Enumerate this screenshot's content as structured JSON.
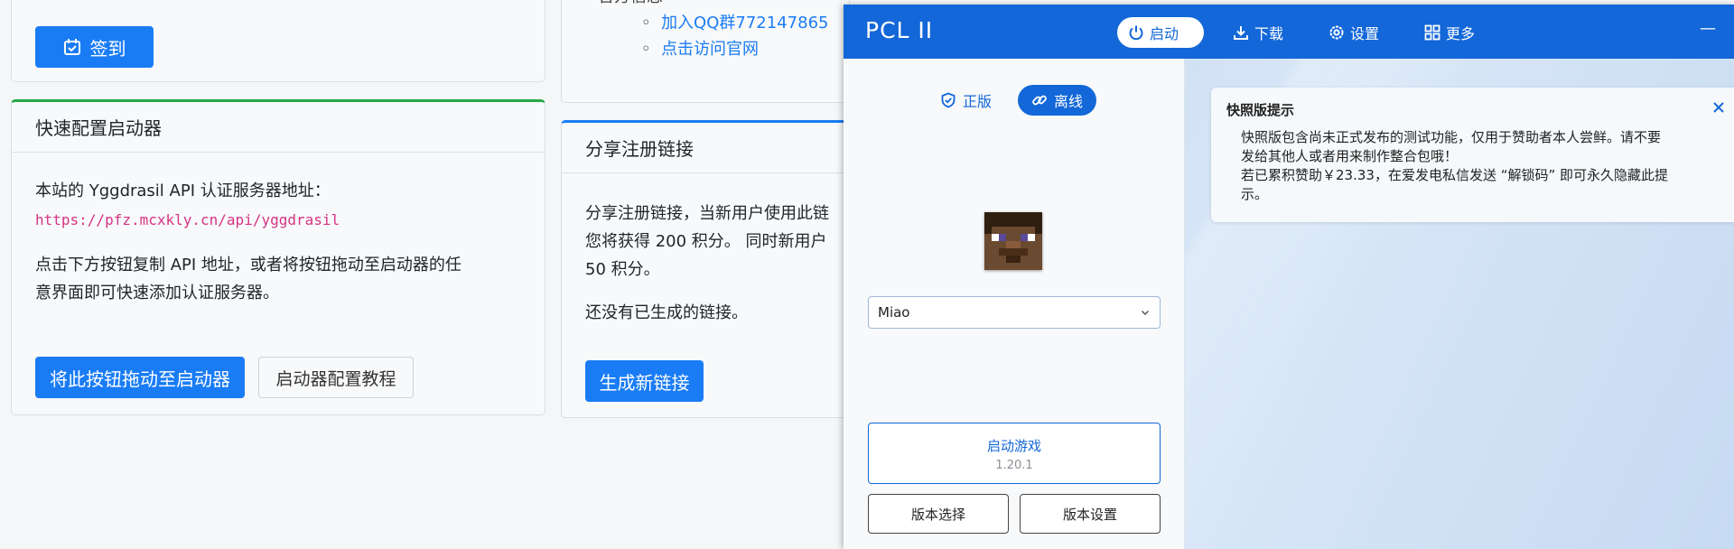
{
  "web": {
    "checkin_label": "签到",
    "quick_config": {
      "title": "快速配置启动器",
      "line1": "本站的 Yggdrasil API 认证服务器地址：",
      "api_url": "https://pfz.mcxkly.cn/api/yggdrasil",
      "line2a": "点击下方按钮复制 API 地址，或者将按钮拖动至启动器的任",
      "line2b": "意界面即可快速添加认证服务器。",
      "drag_button": "将此按钮拖动至启动器",
      "tutorial_button": "启动器配置教程"
    },
    "official": {
      "partial_heading": "官方信息",
      "link_qq": "加入QQ群772147865",
      "link_site": "点击访问官网"
    },
    "share": {
      "title": "分享注册链接",
      "line1": "分享注册链接，当新用户使用此链",
      "line2": "您将获得 200 积分。 同时新用户",
      "line3": "50 积分。",
      "none_text": "还没有已生成的链接。",
      "generate_button": "生成新链接"
    }
  },
  "pcl": {
    "title": "PCL II",
    "nav": [
      {
        "label": "启动",
        "icon": "power-icon",
        "active": true
      },
      {
        "label": "下载",
        "icon": "download-icon",
        "active": false
      },
      {
        "label": "设置",
        "icon": "gear-icon",
        "active": false
      },
      {
        "label": "更多",
        "icon": "grid-icon",
        "active": false
      }
    ],
    "minimize_symbol": "—",
    "login_modes": {
      "genuine": "正版",
      "offline": "离线"
    },
    "username": "Miao",
    "launch": {
      "label": "启动游戏",
      "version": "1.20.1"
    },
    "version_select": "版本选择",
    "version_settings": "版本设置",
    "notice": {
      "title": "快照版提示",
      "line1": "快照版包含尚未正式发布的测试功能，仅用于赞助者本人尝鲜。请不要",
      "line2": "发给其他人或者用来制作整合包哦！",
      "line3": "若已累积赞助￥23.33，在爱发电私信发送 “解锁码” 即可永久隐藏此提",
      "line4": "示。"
    },
    "colors": {
      "accent": "#1367d8",
      "web_primary": "#1a7cf5"
    }
  }
}
